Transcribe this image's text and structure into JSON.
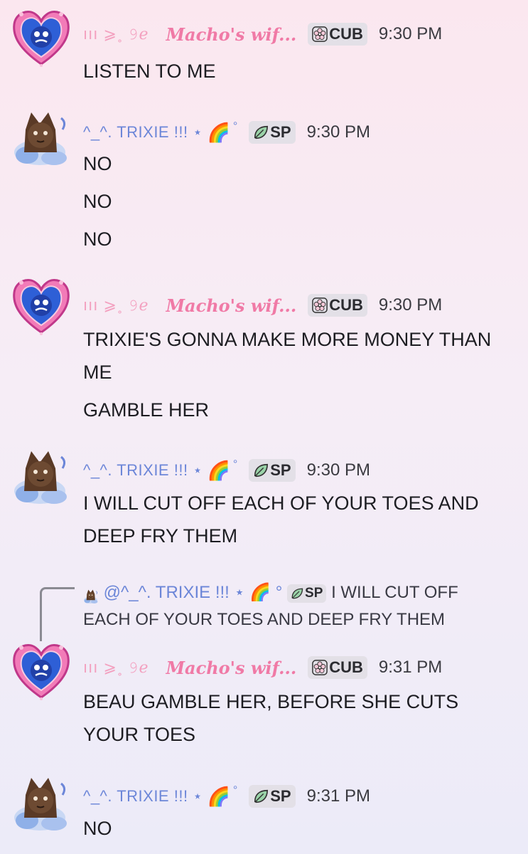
{
  "users": {
    "macho": {
      "prefix": "ııı ⩾˳ 𝟿ℯ",
      "name": "Macho's wif...",
      "tag": "CUB",
      "tag_icon": "sakura-icon"
    },
    "trixie": {
      "name": "^_^. TRIXIE !!! ⋆",
      "emoji": "🌈",
      "deg": "°",
      "tag": "SP",
      "tag_icon": "leaf-icon"
    }
  },
  "messages": [
    {
      "author": "macho",
      "time": "9:30 PM",
      "lines": [
        "LISTEN TO ME"
      ]
    },
    {
      "author": "trixie",
      "time": "9:30 PM",
      "lines": [
        "NO",
        "NO",
        "NO"
      ]
    },
    {
      "author": "macho",
      "time": "9:30 PM",
      "lines": [
        "TRIXIE'S GONNA MAKE MORE MONEY THAN ME",
        "GAMBLE HER"
      ]
    },
    {
      "author": "trixie",
      "time": "9:30 PM",
      "lines": [
        "I WILL CUT OFF EACH OF YOUR TOES AND DEEP FRY THEM"
      ]
    },
    {
      "author": "macho",
      "time": "9:31 PM",
      "lines": [
        "BEAU GAMBLE HER, BEFORE SHE CUTS YOUR TOES"
      ],
      "reply": {
        "mention": "@^_^. TRIXIE !!! ⋆",
        "emoji": "🌈",
        "deg": "°",
        "tag": "SP",
        "text": "I WILL CUT OFF EACH OF YOUR TOES AND DEEP FRY THEM"
      }
    },
    {
      "author": "trixie",
      "time": "9:31 PM",
      "lines": [
        "NO"
      ]
    }
  ]
}
